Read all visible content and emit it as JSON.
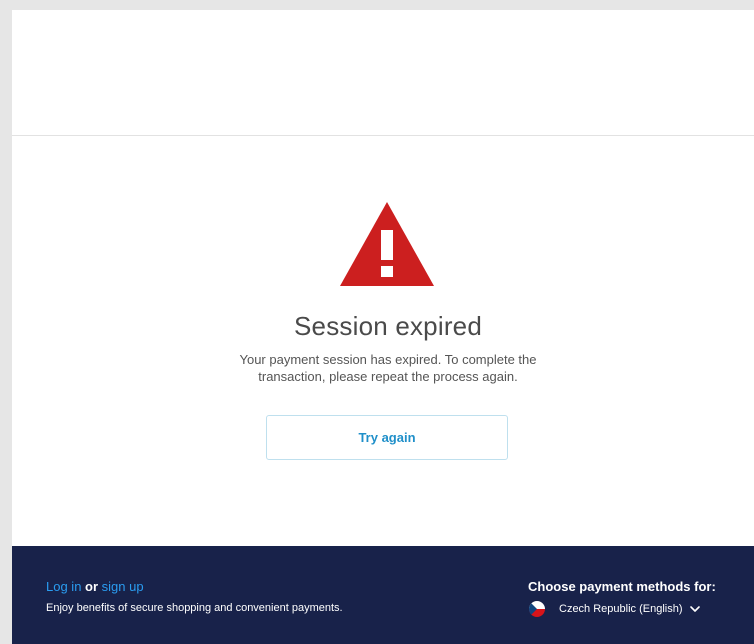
{
  "colors": {
    "warning_red": "#cc1f1f",
    "link_blue": "#2a9cf0",
    "button_text_blue": "#1f8fc9",
    "footer_bg": "#18224a"
  },
  "icons": {
    "warning": "warning-triangle-icon",
    "flag": "czech-flag-icon",
    "chevron": "chevron-down-icon"
  },
  "main": {
    "title": "Session expired",
    "message": "Your payment session has expired. To complete the transaction, please repeat the process again.",
    "try_again_label": "Try again"
  },
  "footer": {
    "login_label": "Log in",
    "or_label": "or",
    "signup_label": "sign up",
    "benefits_text": "Enjoy benefits of secure shopping and convenient payments.",
    "choose_label": "Choose payment methods for:",
    "country_label": "Czech Republic (English)"
  }
}
